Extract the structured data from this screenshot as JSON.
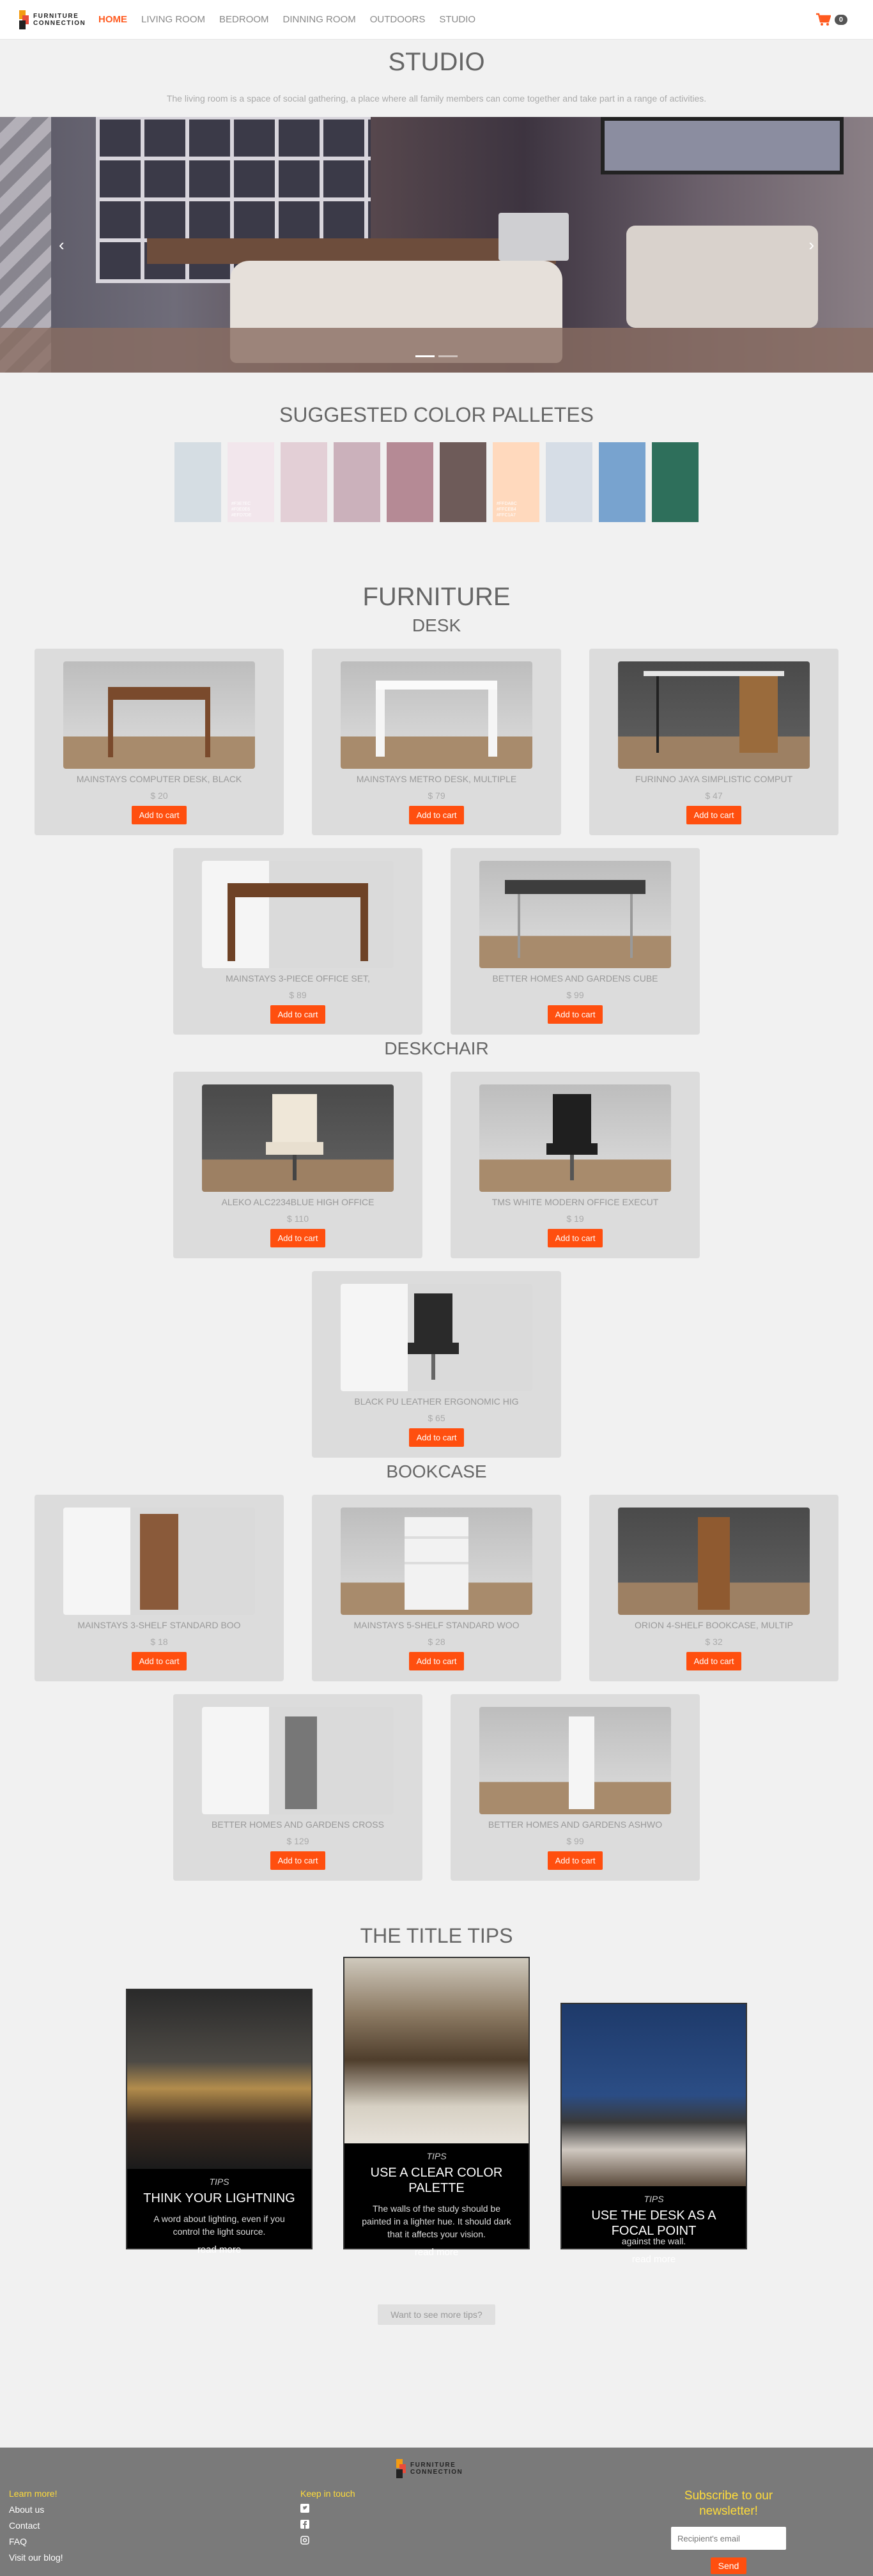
{
  "brand": {
    "name_line1": "FURNITURE",
    "name_line2": "CONNECTION"
  },
  "nav": {
    "items": [
      "HOME",
      "LIVING ROOM",
      "BEDROOM",
      "DINNING ROOM",
      "OUTDOORS",
      "STUDIO"
    ],
    "active": "HOME"
  },
  "cart": {
    "icon": "cart-icon",
    "count": "0"
  },
  "hero": {
    "title": "STUDIO",
    "description": "The living room is a space of social gathering, a place where all family members can come together and take part in a range of activities."
  },
  "palette": {
    "title": "SUGGESTED COLOR PALLETES",
    "swatches": [
      {
        "color": "#d5dde3",
        "label": ""
      },
      {
        "color": "#f2e6ec",
        "label": "#F3E7EC\n#F0E0E6\n#EFD7DE"
      },
      {
        "color": "#e3cfd6",
        "label": ""
      },
      {
        "color": "#cbb1bb",
        "label": ""
      },
      {
        "color": "#b58a95",
        "label": ""
      },
      {
        "color": "#6e5b59",
        "label": ""
      },
      {
        "color": "#ffd9bd",
        "label": "#FFDABC\n#FFCEB4\n#FFC1A7"
      },
      {
        "color": "#d6dde6",
        "label": ""
      },
      {
        "color": "#78a3cf",
        "label": ""
      },
      {
        "color": "#2e6f5b",
        "label": ""
      }
    ]
  },
  "furniture": {
    "title": "FURNITURE",
    "categories": [
      {
        "name": "DESK",
        "items": [
          {
            "name": "MAINSTAYS COMPUTER DESK, BLACK",
            "price": "$ 20",
            "button": "Add to cart"
          },
          {
            "name": "MAINSTAYS METRO DESK, MULTIPLE",
            "price": "$ 79",
            "button": "Add to cart"
          },
          {
            "name": "FURINNO JAYA SIMPLISTIC COMPUT",
            "price": "$ 47",
            "button": "Add to cart"
          },
          {
            "name": "MAINSTAYS 3-PIECE OFFICE SET,",
            "price": "$ 89",
            "button": "Add to cart"
          },
          {
            "name": "BETTER HOMES AND GARDENS CUBE",
            "price": "$ 99",
            "button": "Add to cart"
          }
        ]
      },
      {
        "name": "DESKCHAIR",
        "items": [
          {
            "name": "ALEKO ALC2234BLUE HIGH OFFICE",
            "price": "$ 110",
            "button": "Add to cart"
          },
          {
            "name": "TMS WHITE MODERN OFFICE EXECUT",
            "price": "$ 19",
            "button": "Add to cart"
          },
          {
            "name": "BLACK PU LEATHER ERGONOMIC HIG",
            "price": "$ 65",
            "button": "Add to cart"
          }
        ]
      },
      {
        "name": "BOOKCASE",
        "items": [
          {
            "name": "MAINSTAYS 3-SHELF STANDARD BOO",
            "price": "$ 18",
            "button": "Add to cart"
          },
          {
            "name": "MAINSTAYS 5-SHELF STANDARD WOO",
            "price": "$ 28",
            "button": "Add to cart"
          },
          {
            "name": "ORION 4-SHELF BOOKCASE, MULTIP",
            "price": "$ 32",
            "button": "Add to cart"
          },
          {
            "name": "BETTER HOMES AND GARDENS CROSS",
            "price": "$ 129",
            "button": "Add to cart"
          },
          {
            "name": "BETTER HOMES AND GARDENS ASHWO",
            "price": "$ 99",
            "button": "Add to cart"
          }
        ]
      }
    ]
  },
  "tips": {
    "title": "THE TITLE TIPS",
    "cards": [
      {
        "label": "TIPS",
        "heading": "THINK YOUR LIGHTNING",
        "body": "A word about lighting, even if you control the light source.",
        "link": "read more"
      },
      {
        "label": "TIPS",
        "heading": "USE A CLEAR COLOR PALETTE",
        "body": "The walls of the study should be painted in a lighter hue. It should dark that it affects your vision.",
        "link": "read more"
      },
      {
        "label": "TIPS",
        "heading": "USE THE DESK AS A FOCAL POINT",
        "body": "against the wall.",
        "link": "read more"
      }
    ],
    "more_button": "Want to see more tips?"
  },
  "footer": {
    "col1": {
      "heading": "Learn more!",
      "links": [
        "About us",
        "Contact",
        "FAQ",
        "Visit our blog!"
      ]
    },
    "col2": {
      "heading": "Keep in touch",
      "social": [
        "twitter-icon",
        "facebook-icon",
        "instagram-icon"
      ]
    },
    "col3": {
      "heading": "Subscribe to our newsletter!",
      "placeholder": "Recipient's email",
      "button": "Send"
    }
  }
}
